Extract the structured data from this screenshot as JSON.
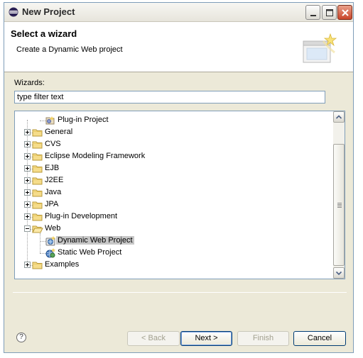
{
  "window": {
    "title": "New Project"
  },
  "header": {
    "title": "Select a wizard",
    "description": "Create a Dynamic Web project"
  },
  "wizards": {
    "label": "Wizards:",
    "filter_value": "type filter text",
    "tree": [
      {
        "label": "Plug-in Project",
        "level": 1,
        "expander": "none",
        "icon": "plugin-project-icon"
      },
      {
        "label": "General",
        "level": 0,
        "expander": "plus",
        "icon": "folder-icon"
      },
      {
        "label": "CVS",
        "level": 0,
        "expander": "plus",
        "icon": "folder-icon"
      },
      {
        "label": "Eclipse Modeling Framework",
        "level": 0,
        "expander": "plus",
        "icon": "folder-icon"
      },
      {
        "label": "EJB",
        "level": 0,
        "expander": "plus",
        "icon": "folder-icon"
      },
      {
        "label": "J2EE",
        "level": 0,
        "expander": "plus",
        "icon": "folder-icon"
      },
      {
        "label": "Java",
        "level": 0,
        "expander": "plus",
        "icon": "folder-icon"
      },
      {
        "label": "JPA",
        "level": 0,
        "expander": "plus",
        "icon": "folder-icon"
      },
      {
        "label": "Plug-in Development",
        "level": 0,
        "expander": "plus",
        "icon": "folder-icon"
      },
      {
        "label": "Web",
        "level": 0,
        "expander": "minus",
        "icon": "folder-open-icon"
      },
      {
        "label": "Dynamic Web Project",
        "level": 1,
        "expander": "none",
        "icon": "dynamic-web-project-icon",
        "selected": true
      },
      {
        "label": "Static Web Project",
        "level": 1,
        "expander": "none",
        "icon": "static-web-project-icon"
      },
      {
        "label": "Examples",
        "level": 0,
        "expander": "plus",
        "icon": "folder-icon"
      }
    ]
  },
  "buttons": {
    "back": "< Back",
    "next": "Next >",
    "finish": "Finish",
    "cancel": "Cancel",
    "help": "?"
  },
  "colors": {
    "selection": "#c7c7c7",
    "border": "#7f9db9",
    "dialog_bg": "#ece9d8",
    "default_button": "#003c74"
  }
}
